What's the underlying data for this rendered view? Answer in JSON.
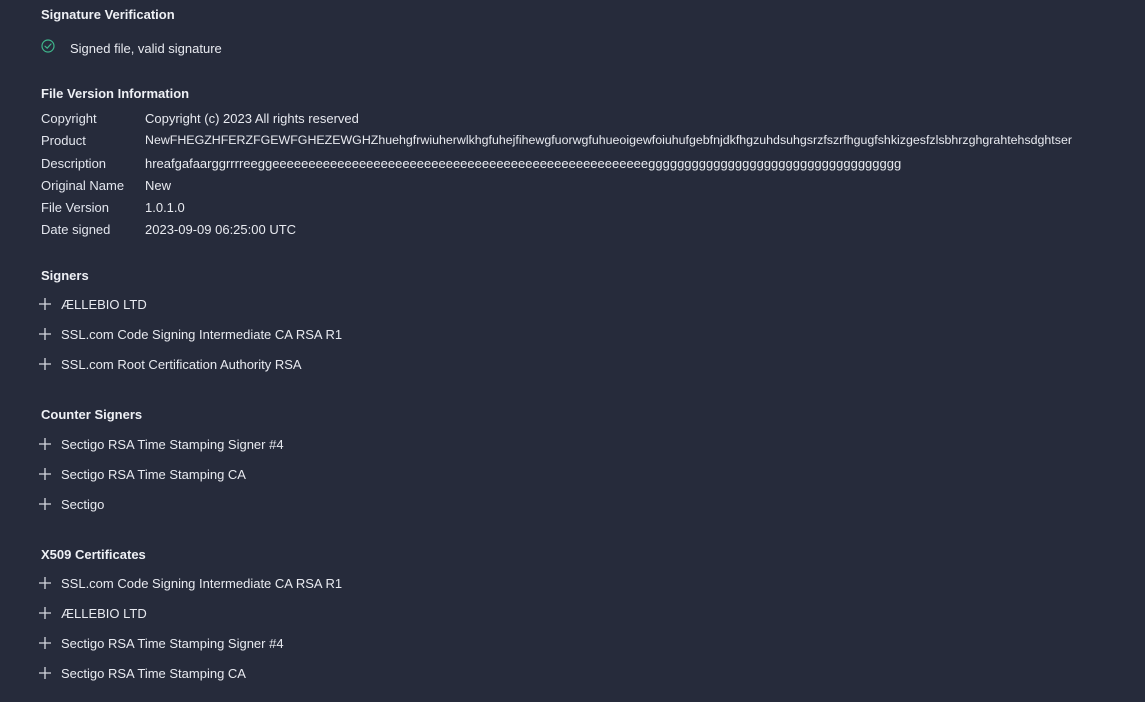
{
  "signature_verification": {
    "title": "Signature Verification",
    "status_text": "Signed file, valid signature",
    "status_icon": "check-circle-icon",
    "status_color": "#3fb68b"
  },
  "file_version": {
    "title": "File Version Information",
    "rows": [
      {
        "key": "Copyright",
        "value": "Copyright (c) 2023 All rights reserved"
      },
      {
        "key": "Product",
        "value": "NewFHEGZHFERZFGEWFGHEZEWGHZhuehgfrwiuherwlkhgfuhejfihewgfuorwgfuhueoigewfoiuhufgebfnjdkfhgzuhdsuhgsrzfszrfhgugfshkizgesfzlsbhrzghgrahtehsdghtser"
      },
      {
        "key": "Description",
        "value": "hreafgafaarggrrrreeggeeeeeeeeeeeeeeeeeeeeeeeeeeeeeeeeeeeeeeeeeeeeeeeeeeeeggggggggggggggggggggggggggggggggggg"
      },
      {
        "key": "Original Name",
        "value": "New"
      },
      {
        "key": "File Version",
        "value": "1.0.1.0"
      },
      {
        "key": "Date signed",
        "value": "2023-09-09 06:25:00 UTC"
      }
    ]
  },
  "signers": {
    "title": "Signers",
    "items": [
      "ÆLLEBIO LTD",
      "SSL.com Code Signing Intermediate CA RSA R1",
      "SSL.com Root Certification Authority RSA"
    ]
  },
  "counter_signers": {
    "title": "Counter Signers",
    "items": [
      "Sectigo RSA Time Stamping Signer #4",
      "Sectigo RSA Time Stamping CA",
      "Sectigo"
    ]
  },
  "x509": {
    "title": "X509 Certificates",
    "items": [
      "SSL.com Code Signing Intermediate CA RSA R1",
      "ÆLLEBIO LTD",
      "Sectigo RSA Time Stamping Signer #4",
      "Sectigo RSA Time Stamping CA"
    ]
  },
  "colors": {
    "background": "#262b3b",
    "text": "#e8eaf0"
  }
}
